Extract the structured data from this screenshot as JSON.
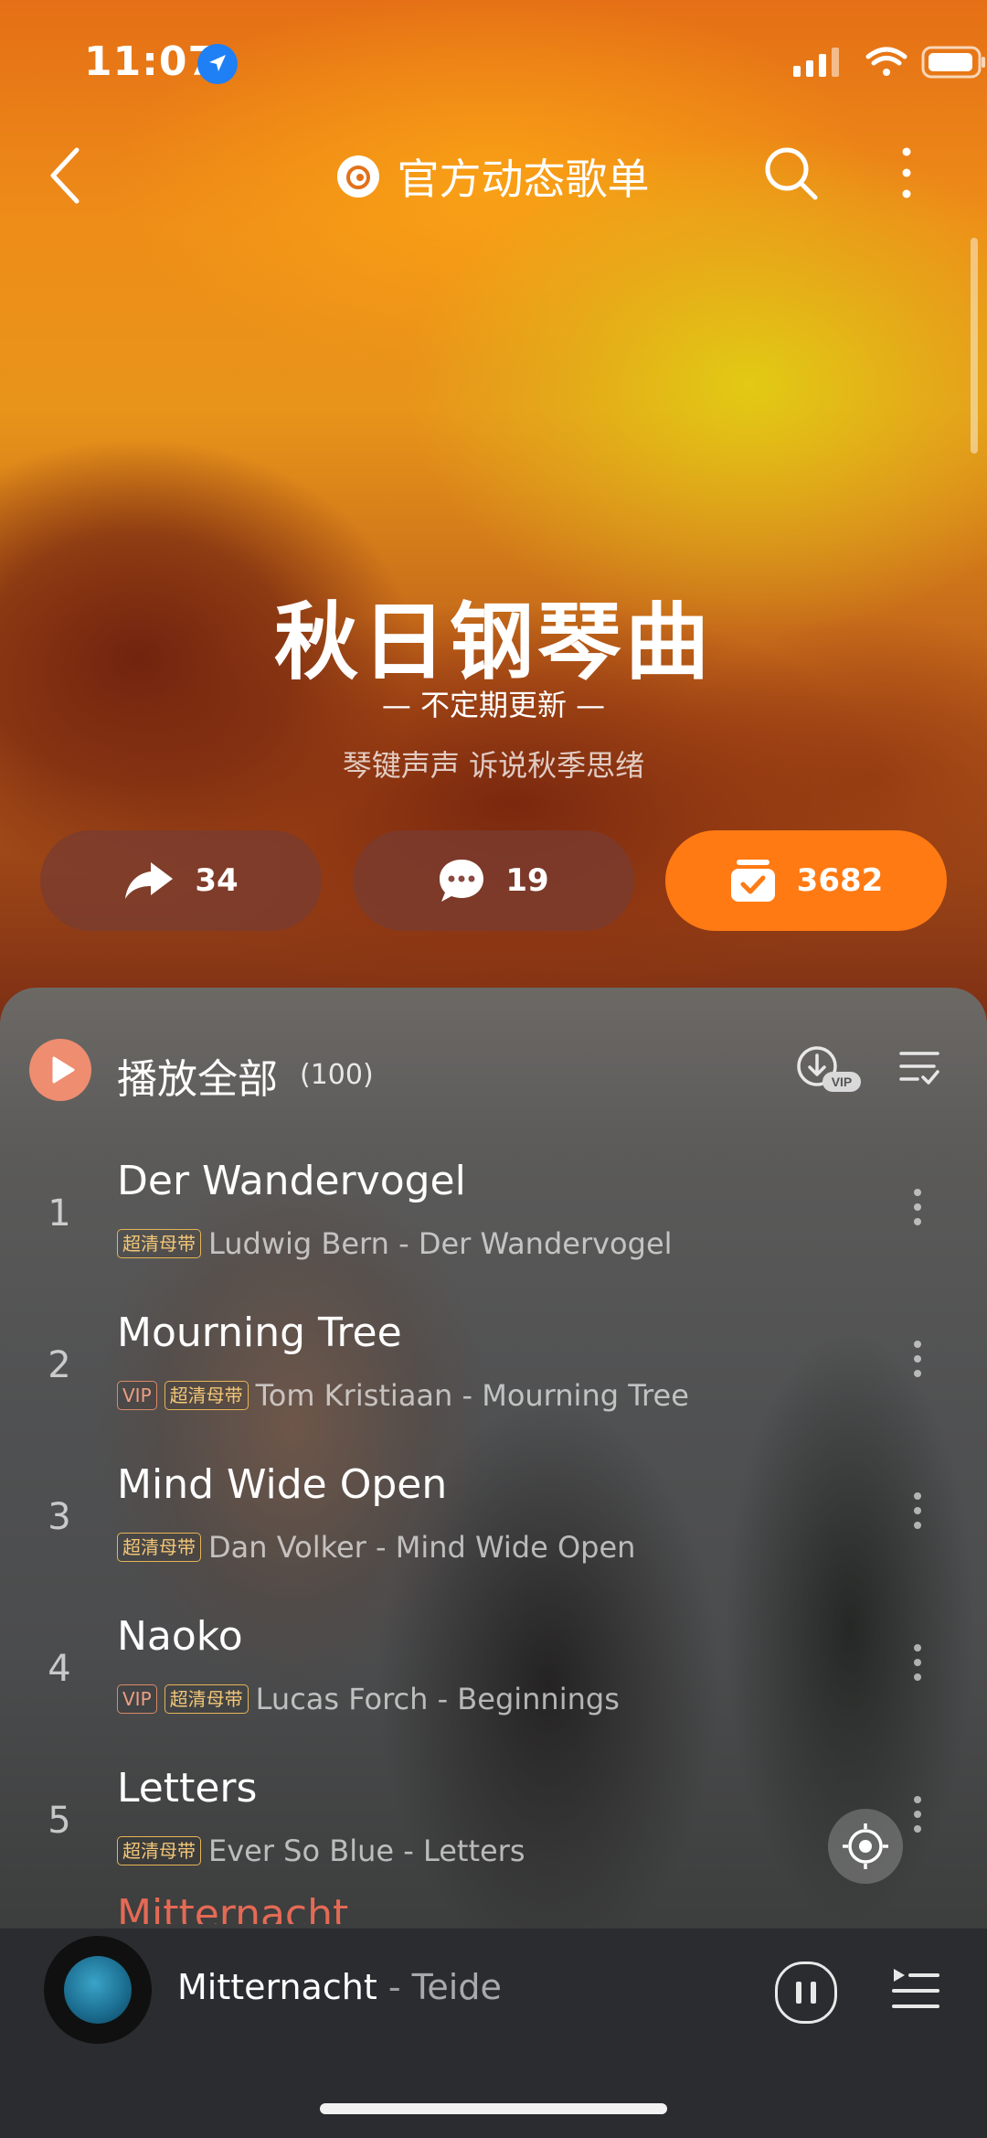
{
  "status_bar": {
    "time": "11:07"
  },
  "header": {
    "title": "官方动态歌单"
  },
  "playlist": {
    "title": "秋日钢琴曲",
    "subtitle": "— 不定期更新 —",
    "description": "琴键声声 诉说秋季思绪"
  },
  "actions": {
    "share_count": "34",
    "comment_count": "19",
    "collect_count": "3682"
  },
  "play_all": {
    "label": "播放全部",
    "count": "(100)"
  },
  "tags": {
    "vip": "VIP",
    "hq": "超清母带"
  },
  "tracks": [
    {
      "num": "1",
      "title": "Der Wandervogel",
      "artist_album": "Ludwig Bern - Der Wandervogel"
    },
    {
      "num": "2",
      "title": "Mourning Tree",
      "artist_album": "Tom Kristiaan - Mourning Tree"
    },
    {
      "num": "3",
      "title": "Mind Wide Open",
      "artist_album": "Dan Volker - Mind Wide Open"
    },
    {
      "num": "4",
      "title": "Naoko",
      "artist_album": "Lucas Forch - Beginnings"
    },
    {
      "num": "5",
      "title": "Letters",
      "artist_album": "Ever So Blue - Letters"
    }
  ],
  "peek_track_title": "Mitternacht",
  "now_playing": {
    "song": "Mitternacht",
    "separator": "-",
    "artist": "Teide"
  },
  "colors": {
    "accent_orange": "#ff7a13",
    "now_playing_red": "#e46a55",
    "tag_gold": "#e6b456"
  }
}
